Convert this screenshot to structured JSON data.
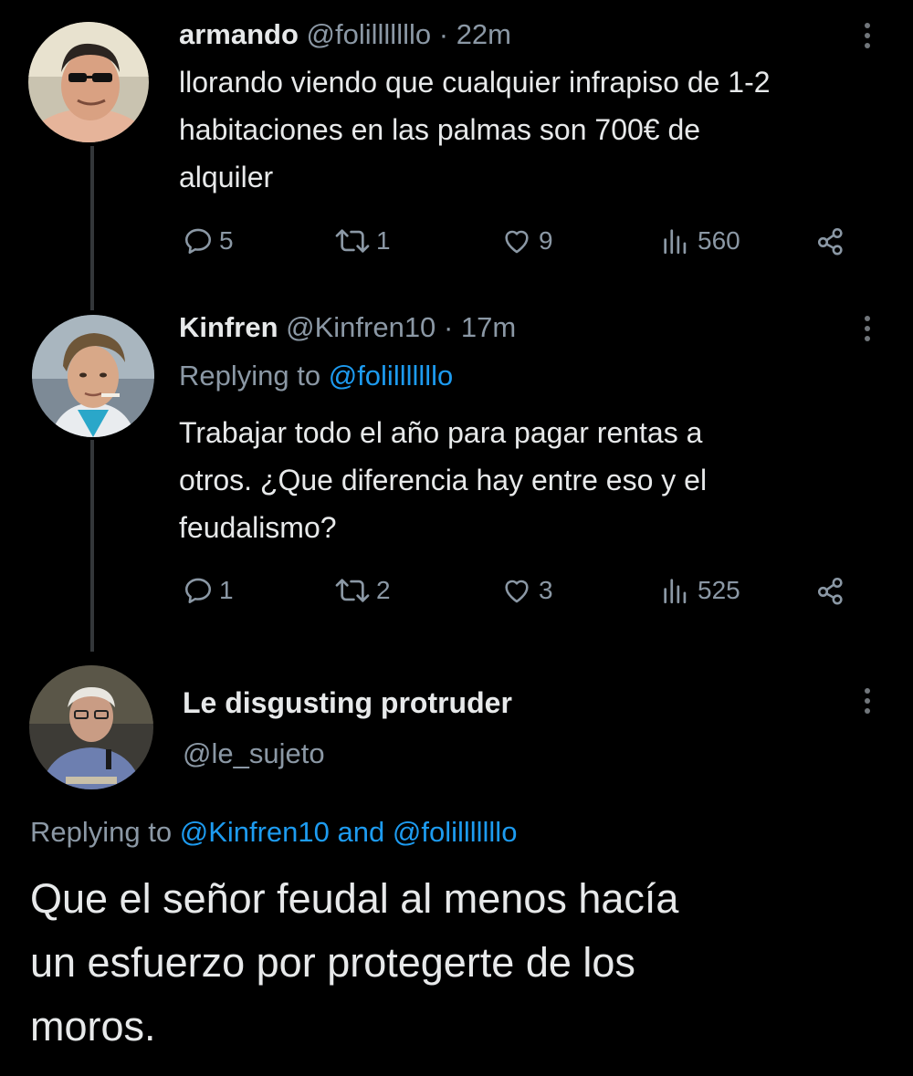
{
  "tweets": [
    {
      "name": "armando",
      "handle": "@folilllllllo",
      "dot": "·",
      "time": "22m",
      "text": "llorando viendo que cualquier infrapiso de 1-2\nhabitaciones en las palmas son 700€ de\nalquiler",
      "replies": "5",
      "retweets": "1",
      "likes": "9",
      "views": "560"
    },
    {
      "name": "Kinfren",
      "handle": "@Kinfren10",
      "dot": "·",
      "time": "17m",
      "replying_prefix": "Replying to",
      "replying_to": "@folilllllllo",
      "text": "Trabajar todo el año para pagar rentas a\notros. ¿Que diferencia hay entre eso y el\nfeudalismo?",
      "replies": "1",
      "retweets": "2",
      "likes": "3",
      "views": "525"
    }
  ],
  "main": {
    "name": "Le disgusting protruder",
    "handle": "@le_sujeto",
    "replying_prefix": "Replying to",
    "replying_to_1": "@Kinfren10",
    "replying_and": "and",
    "replying_to_2": "@folilllllllo",
    "text": "Que el señor feudal al menos hacía\nun esfuerzo por protegerte de los\nmoros."
  },
  "icons": {
    "reply": "reply-icon",
    "retweet": "retweet-icon",
    "like": "heart-icon",
    "views": "views-icon",
    "share": "share-icon",
    "more": "more-icon"
  },
  "colors": {
    "background": "#000000",
    "text": "#e7e9ea",
    "secondary": "#8b98a5",
    "link": "#1d9bf0",
    "thread_line": "#333639"
  }
}
